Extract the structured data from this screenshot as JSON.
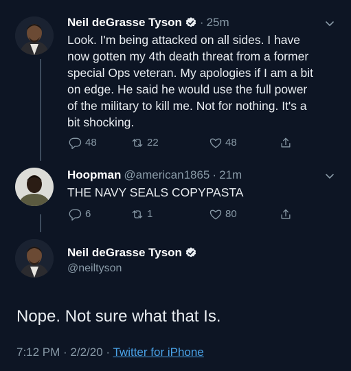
{
  "tweets": [
    {
      "name": "Neil deGrasse Tyson",
      "verified": true,
      "time": "25m",
      "separator": "·",
      "text_lines": [
        "Look. I'm being attacked on all sides. I have",
        "now gotten my 4th death threat from a former",
        "special Ops veteran. My apologies if I am a bit",
        "on edge. He said he would use the full power",
        "of the military to kill me. Not for nothing. It's a",
        "bit shocking."
      ],
      "replies": "48",
      "retweets": "22",
      "likes": "48"
    },
    {
      "name": "Hoopman",
      "handle": "@american1865",
      "separator": "·",
      "time": "21m",
      "text": "THE NAVY SEALS COPYPASTA",
      "replies": "6",
      "retweets": "1",
      "likes": "80"
    }
  ],
  "main_tweet": {
    "name": "Neil deGrasse Tyson",
    "handle": "@neiltyson",
    "text": "Nope. Not sure what that Is.",
    "date_prefix": "7:12 PM · 2/2/20 · ",
    "source": "Twitter for iPhone"
  },
  "colors": {
    "background": "#0d1524",
    "accent": "#1da1f2",
    "muted": "#8899a6"
  },
  "icons": {
    "reply": "reply-icon",
    "retweet": "retweet-icon",
    "like": "heart-icon",
    "share": "share-icon",
    "more": "chevron-down-icon",
    "verified": "verified-badge-icon"
  }
}
